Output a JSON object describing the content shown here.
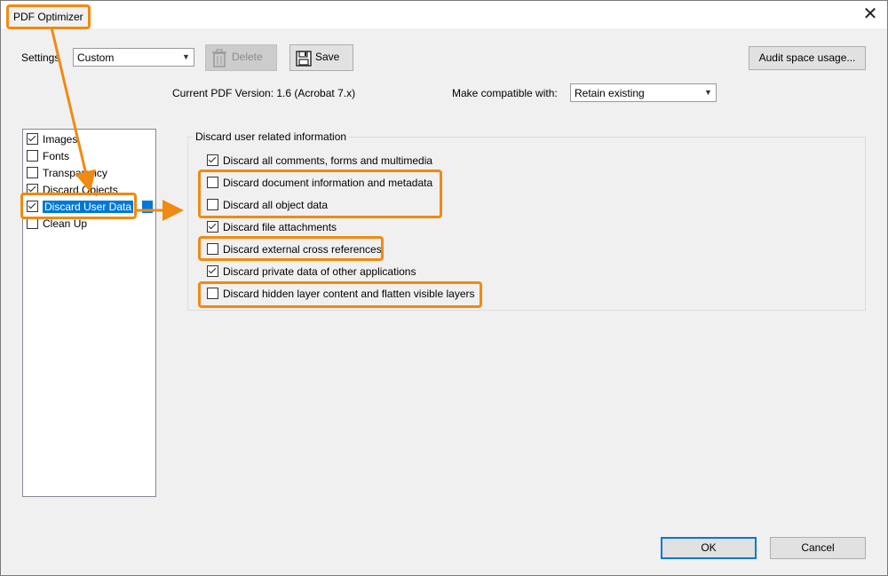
{
  "window": {
    "title": "PDF Optimizer",
    "close_glyph": "✕"
  },
  "settings": {
    "label": "Settings",
    "value": "Custom"
  },
  "toolbar": {
    "delete_label": "Delete",
    "save_label": "Save",
    "audit_label": "Audit space usage..."
  },
  "version": {
    "current_text": "Current PDF Version: 1.6 (Acrobat 7.x)",
    "compat_label": "Make compatible with:",
    "compat_value": "Retain existing"
  },
  "categories": [
    {
      "label": "Images",
      "checked": true
    },
    {
      "label": "Fonts",
      "checked": false
    },
    {
      "label": "Transparency",
      "checked": false
    },
    {
      "label": "Discard Objects",
      "checked": true
    },
    {
      "label": "Discard User Data",
      "checked": true,
      "selected": true
    },
    {
      "label": "Clean Up",
      "checked": false
    }
  ],
  "panel": {
    "group_title": "Discard user related information",
    "options": [
      {
        "label": "Discard all comments, forms and multimedia",
        "checked": true
      },
      {
        "label": "Discard document information and metadata",
        "checked": false
      },
      {
        "label": "Discard all object data",
        "checked": false
      },
      {
        "label": "Discard file attachments",
        "checked": true
      },
      {
        "label": "Discard external cross references",
        "checked": false
      },
      {
        "label": "Discard private data of other applications",
        "checked": true
      },
      {
        "label": "Discard hidden layer content and flatten visible layers",
        "checked": false
      }
    ]
  },
  "footer": {
    "ok_label": "OK",
    "cancel_label": "Cancel"
  },
  "colors": {
    "highlight": "#f08a12",
    "selection": "#0078d7",
    "dialog_bg": "#f0f0f0"
  },
  "icons": {
    "delete": "trash-icon",
    "save": "floppy-disk-icon",
    "dropdown": "chevron-down-icon",
    "close": "close-icon"
  }
}
